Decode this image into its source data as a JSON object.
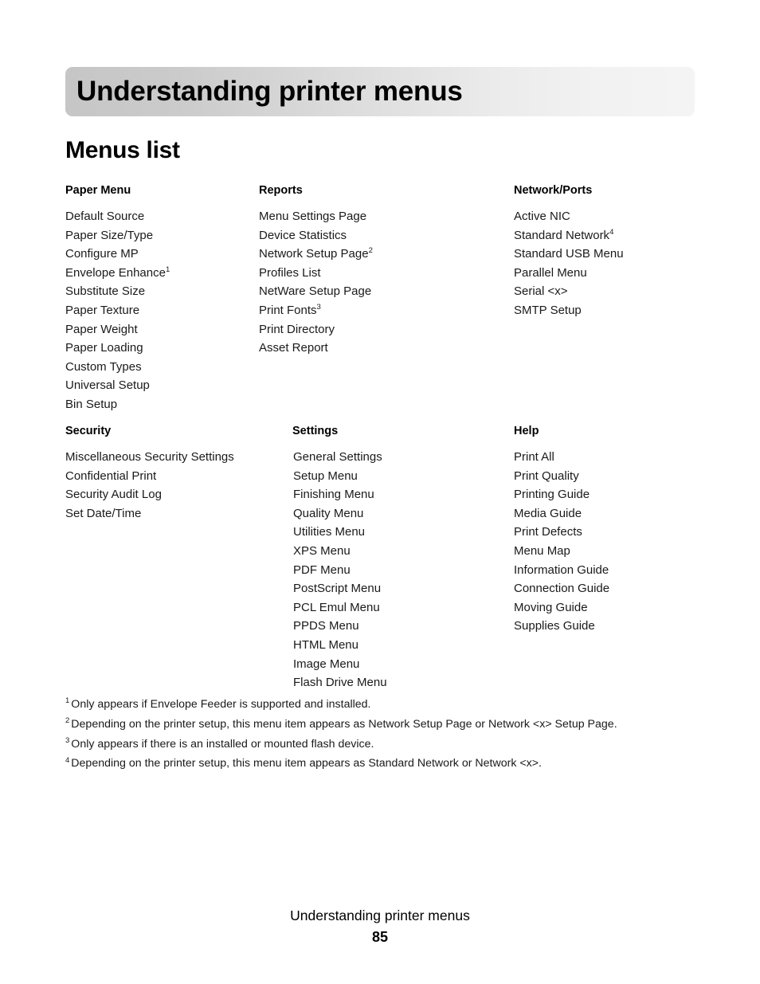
{
  "header": {
    "chapter_title": "Understanding printer menus"
  },
  "section": {
    "heading": "Menus list"
  },
  "menu_blocks": [
    {
      "title": "Paper Menu",
      "items": [
        {
          "label": "Default Source",
          "note": ""
        },
        {
          "label": "Paper Size/Type",
          "note": ""
        },
        {
          "label": "Configure MP",
          "note": ""
        },
        {
          "label": "Envelope Enhance",
          "note": "1"
        },
        {
          "label": "Substitute Size",
          "note": ""
        },
        {
          "label": "Paper Texture",
          "note": ""
        },
        {
          "label": "Paper Weight",
          "note": ""
        },
        {
          "label": "Paper Loading",
          "note": ""
        },
        {
          "label": "Custom Types",
          "note": ""
        },
        {
          "label": "Universal Setup",
          "note": ""
        },
        {
          "label": "Bin Setup",
          "note": ""
        }
      ]
    },
    {
      "title": "Reports",
      "items": [
        {
          "label": "Menu Settings Page",
          "note": ""
        },
        {
          "label": "Device Statistics",
          "note": ""
        },
        {
          "label": "Network Setup Page",
          "note": "2"
        },
        {
          "label": "Profiles List",
          "note": ""
        },
        {
          "label": "NetWare Setup Page",
          "note": ""
        },
        {
          "label": "Print Fonts",
          "note": "3"
        },
        {
          "label": "Print Directory",
          "note": ""
        },
        {
          "label": "Asset Report",
          "note": ""
        }
      ]
    },
    {
      "title": "Network/Ports",
      "items": [
        {
          "label": "Active NIC",
          "note": ""
        },
        {
          "label": "Standard Network",
          "note": "4"
        },
        {
          "label": "Standard USB Menu",
          "note": ""
        },
        {
          "label": "Parallel Menu",
          "note": ""
        },
        {
          "label": "Serial <x>",
          "note": ""
        },
        {
          "label": "SMTP Setup",
          "note": ""
        }
      ]
    },
    {
      "title": "Security",
      "items": [
        {
          "label": "Miscellaneous Security Settings",
          "note": ""
        },
        {
          "label": "Confidential Print",
          "note": ""
        },
        {
          "label": "Security Audit Log",
          "note": ""
        },
        {
          "label": "Set Date/Time",
          "note": ""
        }
      ]
    },
    {
      "title": "Settings",
      "items": [
        {
          "label": "General Settings",
          "note": ""
        },
        {
          "label": "Setup Menu",
          "note": ""
        },
        {
          "label": "Finishing Menu",
          "note": ""
        },
        {
          "label": "Quality Menu",
          "note": ""
        },
        {
          "label": "Utilities Menu",
          "note": ""
        },
        {
          "label": "XPS Menu",
          "note": ""
        },
        {
          "label": "PDF Menu",
          "note": ""
        },
        {
          "label": "PostScript Menu",
          "note": ""
        },
        {
          "label": "PCL Emul Menu",
          "note": ""
        },
        {
          "label": "PPDS Menu",
          "note": ""
        },
        {
          "label": "HTML Menu",
          "note": ""
        },
        {
          "label": "Image Menu",
          "note": ""
        },
        {
          "label": "Flash Drive Menu",
          "note": ""
        }
      ]
    },
    {
      "title": "Help",
      "items": [
        {
          "label": "Print All",
          "note": ""
        },
        {
          "label": "Print Quality",
          "note": ""
        },
        {
          "label": "Printing Guide",
          "note": ""
        },
        {
          "label": "Media Guide",
          "note": ""
        },
        {
          "label": "Print Defects",
          "note": ""
        },
        {
          "label": "Menu Map",
          "note": ""
        },
        {
          "label": "Information Guide",
          "note": ""
        },
        {
          "label": "Connection Guide",
          "note": ""
        },
        {
          "label": "Moving Guide",
          "note": ""
        },
        {
          "label": "Supplies Guide",
          "note": ""
        }
      ]
    }
  ],
  "footnotes": [
    {
      "mark": "1",
      "text": "Only appears if Envelope Feeder is supported and installed."
    },
    {
      "mark": "2",
      "text": "Depending on the printer setup, this menu item appears as Network Setup Page or Network <x> Setup Page."
    },
    {
      "mark": "3",
      "text": "Only appears if there is an installed or mounted flash device."
    },
    {
      "mark": "4",
      "text": "Depending on the printer setup, this menu item appears as Standard Network or Network <x>."
    }
  ],
  "footer": {
    "title": "Understanding printer menus",
    "page_number": "85"
  }
}
